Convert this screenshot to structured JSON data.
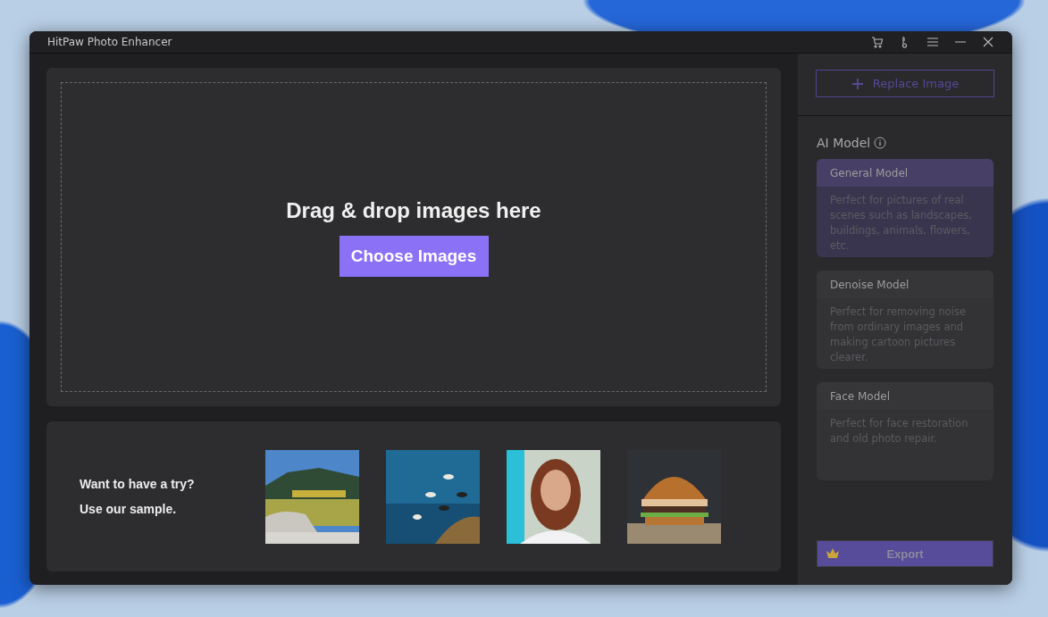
{
  "window": {
    "title": "HitPaw Photo Enhancer"
  },
  "title_bar_icons": [
    {
      "kind": "cart"
    },
    {
      "kind": "key"
    },
    {
      "kind": "menu"
    },
    {
      "kind": "minimize"
    },
    {
      "kind": "close"
    }
  ],
  "drop_zone": {
    "heading": "Drag & drop images here",
    "button": "Choose Images"
  },
  "samples": {
    "lines": [
      "Want to have a try?",
      "Use our sample."
    ],
    "images": [
      {
        "kind": "picture"
      },
      {
        "kind": "picture"
      },
      {
        "kind": "picture"
      },
      {
        "kind": "picture"
      }
    ]
  },
  "sidebar": {
    "replace_button": "Replace Image",
    "section_title": "AI Model",
    "models": [
      {
        "name": "General Model",
        "description": "Perfect for pictures of real scenes such as landscapes, buildings, animals, flowers, etc.",
        "selected": true
      },
      {
        "name": "Denoise Model",
        "description": "Perfect for removing noise from ordinary images and making cartoon pictures clearer.",
        "selected": false
      },
      {
        "name": "Face Model",
        "description": "Perfect for face restoration and old photo repair.",
        "selected": false
      }
    ],
    "export_button": "Export"
  }
}
